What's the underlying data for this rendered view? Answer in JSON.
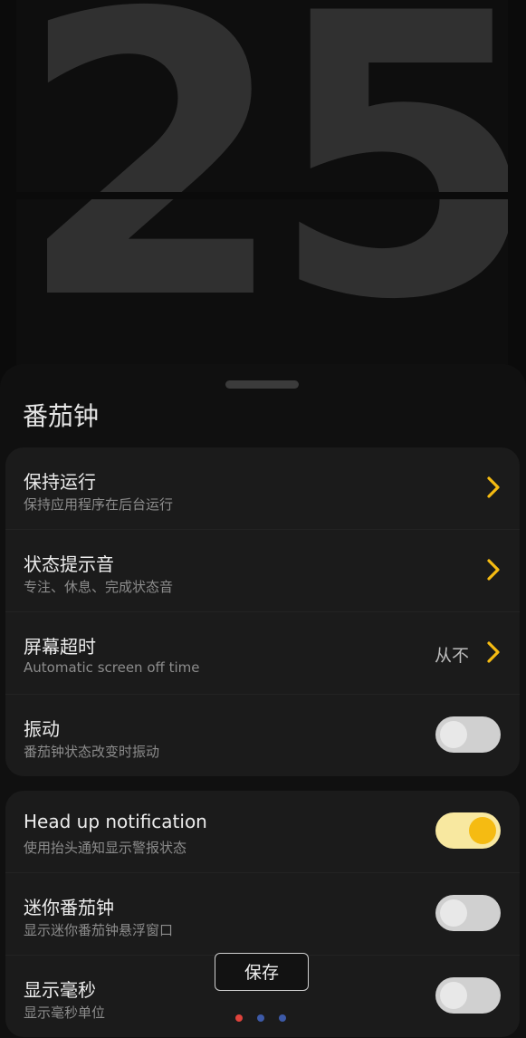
{
  "clock": {
    "digits": "25"
  },
  "sheet": {
    "title": "番茄钟"
  },
  "settings_group_1": [
    {
      "title": "保持运行",
      "subtitle": "保持应用程序在后台运行"
    },
    {
      "title": "状态提示音",
      "subtitle": "专注、休息、完成状态音"
    },
    {
      "title": "屏幕超时",
      "subtitle": "Automatic screen off time",
      "value": "从不"
    },
    {
      "title": "振动",
      "subtitle": "番茄钟状态改变时振动",
      "toggle": false
    }
  ],
  "settings_group_2": [
    {
      "title": "Head up notification",
      "subtitle": "使用抬头通知显示警报状态",
      "toggle": true
    },
    {
      "title": "迷你番茄钟",
      "subtitle": "显示迷你番茄钟悬浮窗口",
      "toggle": false
    },
    {
      "title": "显示毫秒",
      "subtitle": "显示毫秒单位",
      "toggle": false
    }
  ],
  "save_button": {
    "label": "保存"
  },
  "page_indicator": {
    "count": 3,
    "active_index": 0,
    "colors": {
      "active": "#e0433c",
      "inactive": "#3d5aa8"
    }
  },
  "colors": {
    "accent": "#f5bb12",
    "toggle_on_track": "#f8e8a0",
    "toggle_off_track": "#d0d0d0",
    "card_bg": "#1b1b1b",
    "clock_digits": "#303030"
  },
  "icons": {
    "row_chevron": "chevron-right-icon"
  }
}
